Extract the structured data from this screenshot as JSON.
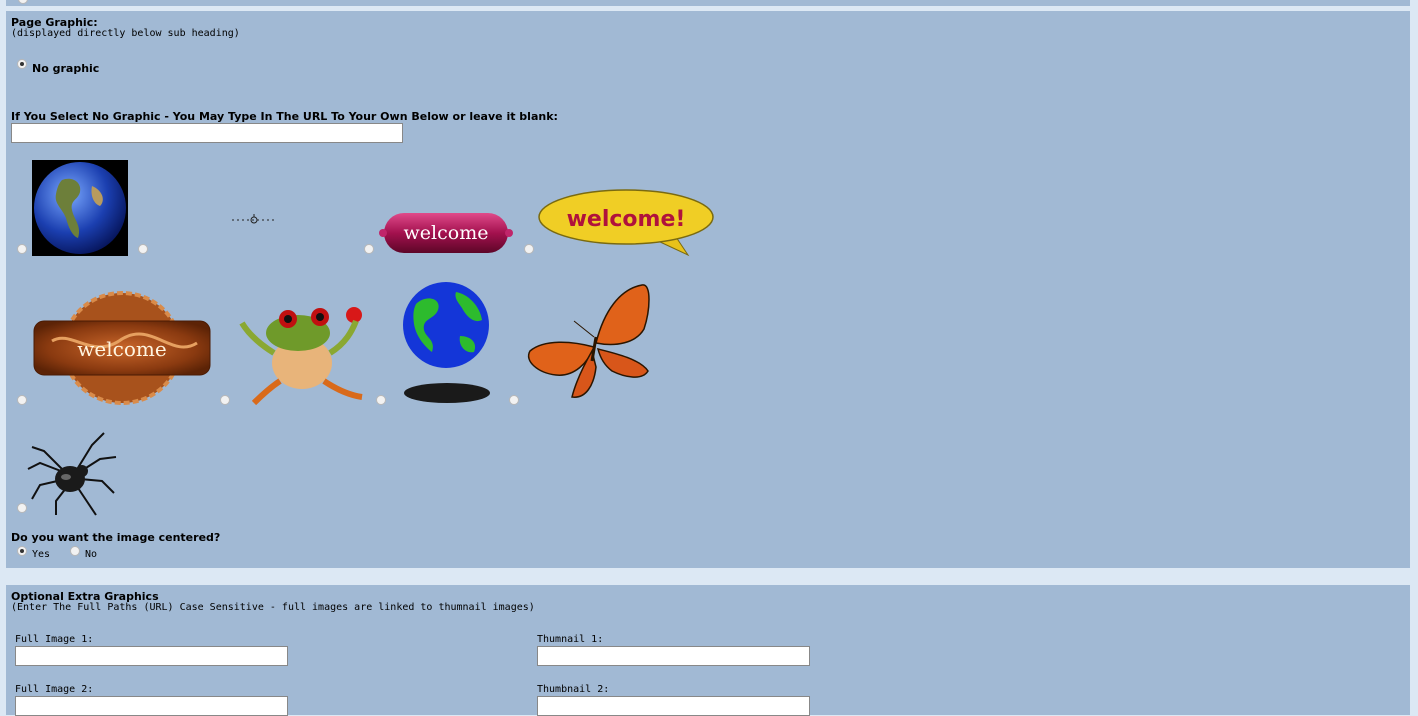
{
  "page_graphic": {
    "title": "Page Graphic:",
    "subtitle": "(displayed directly below sub heading)",
    "no_graphic_label": "No graphic",
    "url_label": "If You Select No Graphic - You May Type In The URL To Your Own Below or leave it blank:",
    "url_value": "",
    "welcome_sausage_text": "welcome",
    "welcome_bubble_text": "welcome!",
    "welcome_plaque_text": "welcome",
    "center_question": "Do you want the image centered?",
    "center_yes": "Yes",
    "center_no": "No"
  },
  "extra_graphics": {
    "title": "Optional Extra Graphics",
    "subtitle": "(Enter The Full Paths (URL) Case Sensitive - full images are linked to thumnail images)",
    "full_image_1_label": "Full Image 1:",
    "thumbnail_1_label": "Thumnail 1:",
    "full_image_2_label": "Full Image 2:",
    "thumbnail_2_label": "Thumbnail 2:"
  },
  "colors": {
    "panel": "#a1b9d4",
    "background": "#dce8f4"
  }
}
